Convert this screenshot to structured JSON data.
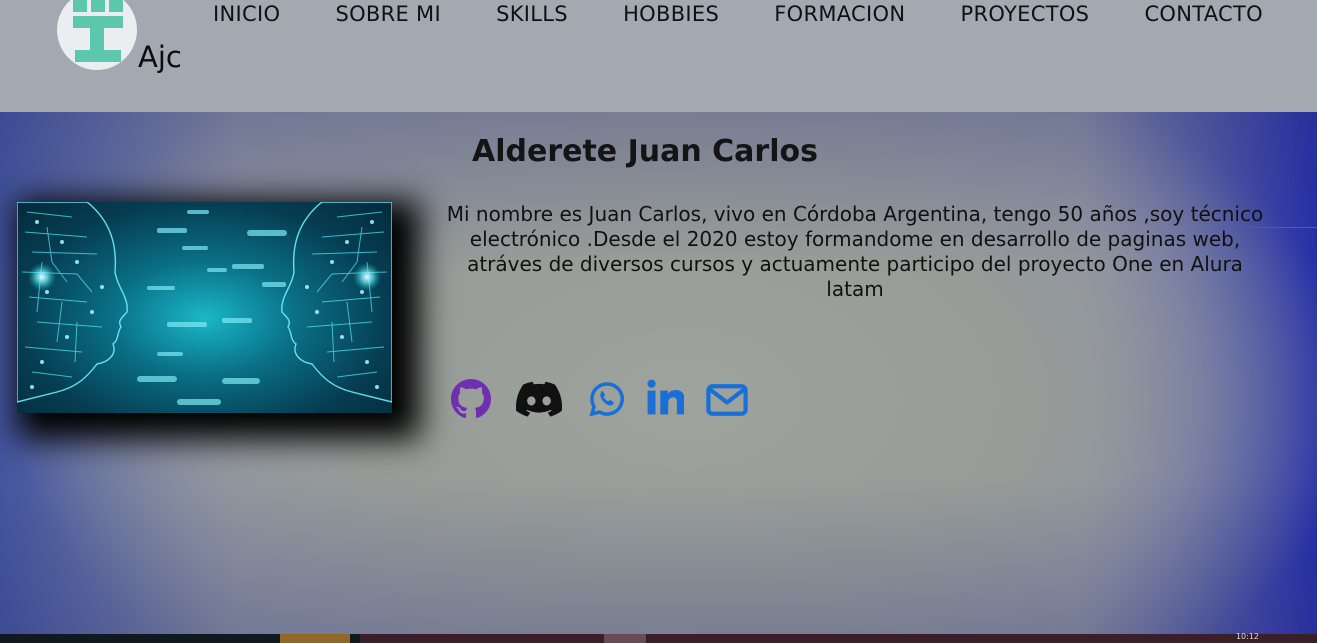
{
  "brand": {
    "name": "Ajc"
  },
  "nav": {
    "items": [
      "INICIO",
      "SOBRE MI",
      "SKILLS",
      "HOBBIES",
      "FORMACION",
      "PROYECTOS",
      "CONTACTO"
    ]
  },
  "profile": {
    "name": "Alderete Juan Carlos",
    "bio": "Mi nombre es Juan Carlos, vivo en Córdoba Argentina, tengo 50 años ,soy técnico electrónico .Desde el 2020 estoy formandome en desarrollo de paginas web, atráves de diversos cursos y actuamente participo del proyecto One en Alura latam"
  },
  "social_links": [
    {
      "icon": "github-icon",
      "color": "#6e2fb0"
    },
    {
      "icon": "discord-icon",
      "color": "#111111"
    },
    {
      "icon": "whatsapp-icon",
      "color": "#1a6fd6"
    },
    {
      "icon": "linkedin-icon",
      "color": "#1a6fd6"
    },
    {
      "icon": "envelope-icon",
      "color": "#1a6fd6"
    }
  ],
  "taskbar": {
    "clock": "10:12"
  }
}
